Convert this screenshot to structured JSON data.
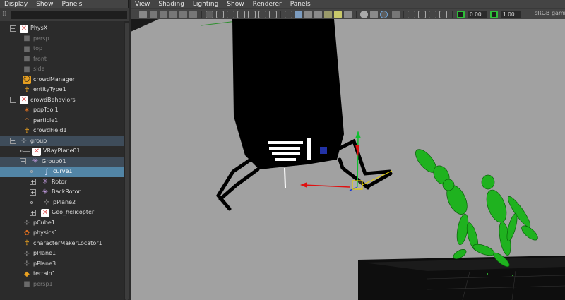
{
  "outliner": {
    "menu": [
      "Display",
      "Show",
      "Panels"
    ],
    "search_value": "",
    "items": [
      {
        "label": "PhysX",
        "icon": "physx-icon",
        "indent": 0,
        "expander": "+",
        "state": "normal"
      },
      {
        "label": "persp",
        "icon": "camera-icon",
        "indent": 1,
        "expander": "",
        "state": "dim"
      },
      {
        "label": "top",
        "icon": "camera-icon",
        "indent": 1,
        "expander": "",
        "state": "dim"
      },
      {
        "label": "front",
        "icon": "camera-icon",
        "indent": 1,
        "expander": "",
        "state": "dim"
      },
      {
        "label": "side",
        "icon": "camera-icon",
        "indent": 1,
        "expander": "",
        "state": "dim"
      },
      {
        "label": "crowdManager",
        "icon": "crowd-manager-icon",
        "indent": 1,
        "expander": "",
        "state": "normal"
      },
      {
        "label": "entityType1",
        "icon": "entity-type-icon",
        "indent": 1,
        "expander": "",
        "state": "normal"
      },
      {
        "label": "crowdBehaviors",
        "icon": "crowd-behaviors-icon",
        "indent": 0,
        "expander": "+",
        "state": "normal"
      },
      {
        "label": "popTool1",
        "icon": "pop-tool-icon",
        "indent": 1,
        "expander": "",
        "state": "normal"
      },
      {
        "label": "particle1",
        "icon": "particle-icon",
        "indent": 1,
        "expander": "",
        "state": "normal"
      },
      {
        "label": "crowdField1",
        "icon": "crowd-field-icon",
        "indent": 1,
        "expander": "",
        "state": "normal"
      },
      {
        "label": "group",
        "icon": "group-icon",
        "indent": 0,
        "expander": "-",
        "state": "sel-parent"
      },
      {
        "label": "VRayPlane01",
        "icon": "vray-plane-icon",
        "indent": 2,
        "expander": "",
        "state": "normal"
      },
      {
        "label": "Group01",
        "icon": "group01-icon",
        "indent": 1,
        "expander": "-",
        "state": "sel-parent"
      },
      {
        "label": "curve1",
        "icon": "curve-icon",
        "indent": 3,
        "expander": "",
        "state": "sel"
      },
      {
        "label": "Rotor",
        "icon": "rotor-icon",
        "indent": 2,
        "expander": "+",
        "state": "normal"
      },
      {
        "label": "BackRotor",
        "icon": "rotor-icon",
        "indent": 2,
        "expander": "+",
        "state": "normal"
      },
      {
        "label": "pPlane2",
        "icon": "mesh-icon",
        "indent": 3,
        "expander": "",
        "state": "normal"
      },
      {
        "label": "Geo_helicopter",
        "icon": "geo-icon",
        "indent": 2,
        "expander": "+",
        "state": "normal"
      },
      {
        "label": "pCube1",
        "icon": "mesh-icon",
        "indent": 1,
        "expander": "",
        "state": "normal"
      },
      {
        "label": "physics1",
        "icon": "physics-icon",
        "indent": 1,
        "expander": "",
        "state": "normal"
      },
      {
        "label": "characterMakerLocator1",
        "icon": "character-maker-icon",
        "indent": 1,
        "expander": "",
        "state": "normal"
      },
      {
        "label": "pPlane1",
        "icon": "mesh-icon",
        "indent": 1,
        "expander": "",
        "state": "normal"
      },
      {
        "label": "pPlane3",
        "icon": "mesh-icon",
        "indent": 1,
        "expander": "",
        "state": "normal"
      },
      {
        "label": "terrain1",
        "icon": "terrain-icon",
        "indent": 1,
        "expander": "",
        "state": "normal"
      },
      {
        "label": "persp1",
        "icon": "camera-icon",
        "indent": 1,
        "expander": "",
        "state": "dim"
      }
    ]
  },
  "viewport": {
    "menu": [
      "View",
      "Shading",
      "Lighting",
      "Show",
      "Renderer",
      "Panels"
    ],
    "exposure_value": "0.00",
    "gamma_value": "1.00",
    "color_space": "sRGB gamm"
  },
  "colors": {
    "panel_bg": "#2b2b2b",
    "selection": "#5285a6",
    "viewport_bg": "#a1a1a1",
    "agent_green": "#1fb21f",
    "manip_red": "#e01010",
    "manip_green": "#10c030",
    "manip_blue": "#1030e0"
  }
}
